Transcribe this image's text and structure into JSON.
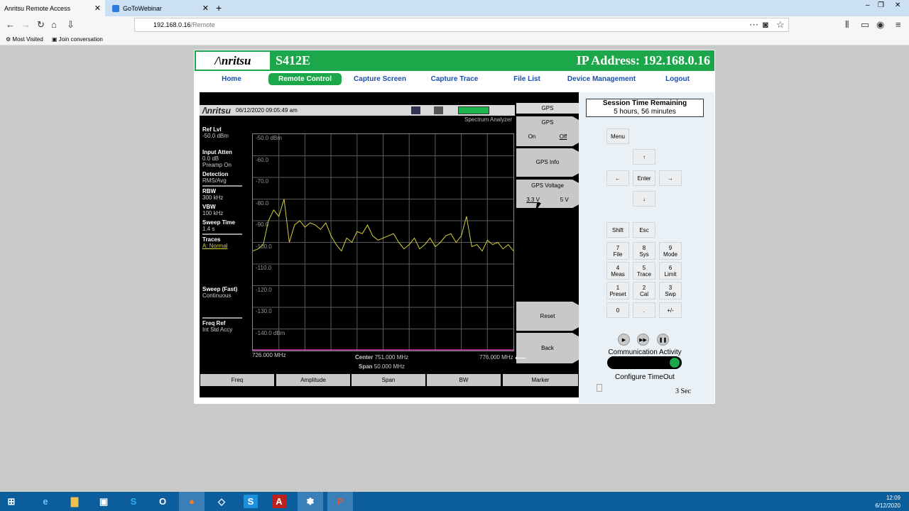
{
  "browser": {
    "tabs": [
      {
        "label": "Anritsu Remote Access",
        "active": true
      },
      {
        "label": "GoToWebinar",
        "active": false
      }
    ],
    "new_tab": "+",
    "url_host": "192.168.0.16",
    "url_path": "/Remote",
    "bookmarks": [
      "Most Visited",
      "Join conversation"
    ]
  },
  "header": {
    "logo": "/\\nritsu",
    "model": "S412E",
    "ip": "IP Address: 192.168.0.16"
  },
  "menu": [
    {
      "label": "Home",
      "active": false
    },
    {
      "label": "Remote Control",
      "active": true
    },
    {
      "label": "Capture Screen",
      "active": false
    },
    {
      "label": "Capture Trace",
      "active": false
    },
    {
      "label": "File List",
      "active": false
    },
    {
      "label": "Device Management",
      "active": false
    },
    {
      "label": "Logout",
      "active": false
    }
  ],
  "instrument": {
    "brand": "/\\nritsu",
    "datetime": "06/12/2020 09:05:49 am",
    "mode": "Spectrum Analyzer",
    "side": {
      "ref_lvl_title": "Ref Lvl",
      "ref_lvl_val": "-50.0 dBm",
      "input_atten_title": "Input Atten",
      "input_atten_val": "0.0 dB",
      "preamp": "Preamp On",
      "detection_title": "Detection",
      "detection_val": "RMS/Avg",
      "rbw_title": "RBW",
      "rbw_val": "300 kHz",
      "vbw_title": "VBW",
      "vbw_val": "100 kHz",
      "sweep_time_title": "Sweep Time",
      "sweep_time_val": "1.4 s",
      "traces_title": "Traces",
      "traces_val": "A: Normal",
      "sweep_title": "Sweep (Fast)",
      "sweep_val": "Continuous",
      "freq_ref_title": "Freq Ref",
      "freq_ref_val": "Int Std Accy"
    },
    "x_start": "726.000 MHz",
    "x_stop": "776.000 MHz",
    "center_label": "Center",
    "center_val": "751.000 MHz",
    "span_label": "Span",
    "span_val": "50.000 MHz",
    "softkeys": {
      "header": "GPS",
      "gps_title": "GPS",
      "gps_on": "On",
      "gps_off": "Off",
      "gps_info": "GPS Info",
      "gps_voltage": "GPS Voltage",
      "v33": "3.3 V",
      "v5": "5 V",
      "reset": "Reset",
      "back": "Back"
    },
    "bottom_keys": [
      "Freq",
      "Amplitude",
      "Span",
      "BW",
      "Marker"
    ]
  },
  "chart_data": {
    "type": "line",
    "ylim": [
      -150,
      -50
    ],
    "xlim": [
      726,
      776
    ],
    "y_tick_labels": [
      "-50.0 dBm",
      "-60.0",
      "-70.0",
      "-80.0",
      "-90.0",
      "-100.0",
      "-110.0",
      "-120.0",
      "-130.0",
      "-140.0 dBm"
    ],
    "grid": true,
    "series": [
      {
        "color": "#d8cf3a",
        "x": [
          726,
          727,
          728,
          729,
          730,
          731,
          732,
          733,
          734,
          735,
          736,
          737,
          738,
          739,
          740,
          741,
          742,
          743,
          744,
          745,
          746,
          747,
          748,
          749,
          750,
          751,
          752,
          753,
          754,
          755,
          756,
          757,
          758,
          759,
          760,
          761,
          762,
          763,
          764,
          765,
          766,
          767,
          768,
          769,
          770,
          771,
          772,
          773,
          774,
          775,
          776
        ],
        "y": [
          -104,
          -103,
          -101,
          -90,
          -85,
          -88,
          -80,
          -100,
          -92,
          -90,
          -93,
          -91,
          -92,
          -94,
          -91,
          -97,
          -101,
          -104,
          -98,
          -100,
          -95,
          -96,
          -92,
          -97,
          -99,
          -98,
          -97,
          -96,
          -100,
          -103,
          -101,
          -98,
          -103,
          -101,
          -98,
          -102,
          -100,
          -97,
          -96,
          -100,
          -97,
          -88,
          -102,
          -101,
          -104,
          -99,
          -101,
          -100,
          -103,
          -101,
          -104
        ]
      }
    ]
  },
  "remote": {
    "session_title": "Session Time Remaining",
    "session_val": "5 hours, 56 minutes",
    "menu": "Menu",
    "up": "↑",
    "left": "←",
    "enter": "Enter",
    "right": "→",
    "down": "↓",
    "shift": "Shift",
    "esc": "Esc",
    "numkeys": [
      {
        "n": "7",
        "l": "File"
      },
      {
        "n": "8",
        "l": "Sys"
      },
      {
        "n": "9",
        "l": "Mode"
      },
      {
        "n": "4",
        "l": "Meas"
      },
      {
        "n": "5",
        "l": "Trace"
      },
      {
        "n": "6",
        "l": "Limit"
      },
      {
        "n": "1",
        "l": "Preset"
      },
      {
        "n": "2",
        "l": "Cal"
      },
      {
        "n": "3",
        "l": "Swp"
      }
    ],
    "zero": "0",
    "dot": ".",
    "plusminus": "+/-",
    "comm_label": "Communication Activity",
    "cfg_label": "Configure TimeOut",
    "timeout_val": "3 Sec"
  },
  "taskbar": {
    "time": "12:09",
    "date": "6/12/2020"
  }
}
